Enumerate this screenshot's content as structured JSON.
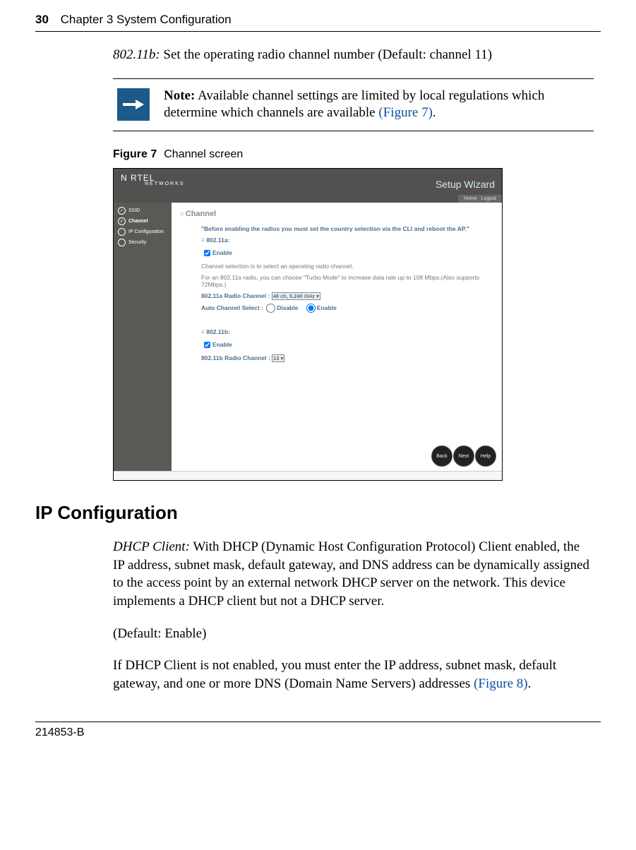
{
  "header": {
    "page_num": "30",
    "chapter": "Chapter 3  System Configuration"
  },
  "para1_prefix_italic": "802.11b:",
  "para1_rest": " Set the operating radio channel number (Default: channel 11)",
  "note": {
    "label": "Note:",
    "body": " Available channel settings are limited by local regulations which determine which channels are available ",
    "link": "(Figure 7)",
    "period": "."
  },
  "figure": {
    "label": "Figure 7",
    "caption": "Channel screen"
  },
  "shot": {
    "brand_a": "N   RTEL",
    "brand_b": "NETWORKS",
    "setup": "Setup Wizard",
    "util_home": "Home",
    "util_logout": "Logout",
    "side": {
      "ssid": "SSID",
      "channel": "Channel",
      "ipconf": "IP Configuration",
      "security": "Security"
    },
    "main": {
      "title": "Channel",
      "warn": "\"Before enabling the radios you must set the country selection via the CLI and reboot the AP.\"",
      "sec_a": "802.11a:",
      "enable": "Enable",
      "desc1": "Channel selection is to select an operating radio channel.",
      "desc2": "For an 802.11a radio, you can choose \"Turbo Mode\" to increase data rate up to 108 Mbps.(Also supports 72Mbps.)",
      "rc_a_label": "802.11a Radio Channel : ",
      "rc_a_value": "48 ch, 5.240 GHz",
      "auto_label": "Auto Channel Select :  ",
      "auto_disable": "Disable",
      "auto_enable": "Enable",
      "sec_b": "802.11b:",
      "rc_b_label": "802.11b Radio Channel : ",
      "rc_b_value": "13"
    },
    "nav": {
      "back": "Back",
      "next": "Next",
      "help": "Help"
    }
  },
  "h2": "IP Configuration",
  "para2_prefix_italic": "DHCP Client:",
  "para2_rest": " With DHCP (Dynamic Host Configuration Protocol) Client enabled, the IP address, subnet mask, default gateway, and DNS address can be dynamically assigned to the access point by an external network DHCP server on the network. This device implements a DHCP client but not a DHCP server.",
  "para3": "(Default: Enable)",
  "para4_a": "If DHCP Client is not enabled, you must enter the IP address, subnet mask, default gateway, and one or more DNS (Domain Name Servers) addresses ",
  "para4_link": "(Figure 8)",
  "para4_b": ".",
  "footer": "214853-B"
}
